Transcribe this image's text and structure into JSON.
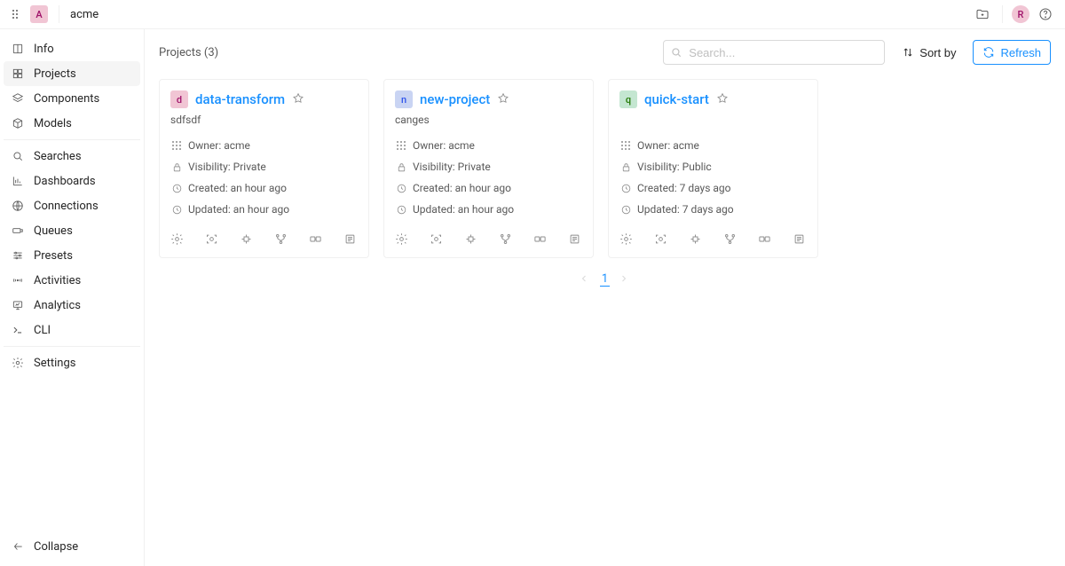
{
  "header": {
    "org_letter": "A",
    "org_name": "acme",
    "user_letter": "R"
  },
  "sidebar": {
    "items": [
      {
        "label": "Info"
      },
      {
        "label": "Projects"
      },
      {
        "label": "Components"
      },
      {
        "label": "Models"
      },
      {
        "label": "Searches"
      },
      {
        "label": "Dashboards"
      },
      {
        "label": "Connections"
      },
      {
        "label": "Queues"
      },
      {
        "label": "Presets"
      },
      {
        "label": "Activities"
      },
      {
        "label": "Analytics"
      },
      {
        "label": "CLI"
      },
      {
        "label": "Settings"
      }
    ],
    "collapse_label": "Collapse"
  },
  "main": {
    "title": "Projects (3)",
    "search_placeholder": "Search...",
    "sort_label": "Sort by",
    "refresh_label": "Refresh"
  },
  "projects": [
    {
      "letter": "d",
      "badge_bg": "#f1c5d4",
      "badge_fg": "#9e1068",
      "name": "data-transform",
      "desc": "sdfsdf",
      "owner_label": "Owner: acme",
      "visibility_label": "Visibility: Private",
      "created_label": "Created: an hour ago",
      "updated_label": "Updated: an hour ago"
    },
    {
      "letter": "n",
      "badge_bg": "#c9d4f3",
      "badge_fg": "#2f54eb",
      "name": "new-project",
      "desc": "canges",
      "owner_label": "Owner: acme",
      "visibility_label": "Visibility: Private",
      "created_label": "Created: an hour ago",
      "updated_label": "Updated: an hour ago"
    },
    {
      "letter": "q",
      "badge_bg": "#c4e6d1",
      "badge_fg": "#237804",
      "name": "quick-start",
      "desc": "",
      "owner_label": "Owner: acme",
      "visibility_label": "Visibility: Public",
      "created_label": "Created: 7 days ago",
      "updated_label": "Updated: 7 days ago"
    }
  ],
  "pagination": {
    "current": "1"
  }
}
